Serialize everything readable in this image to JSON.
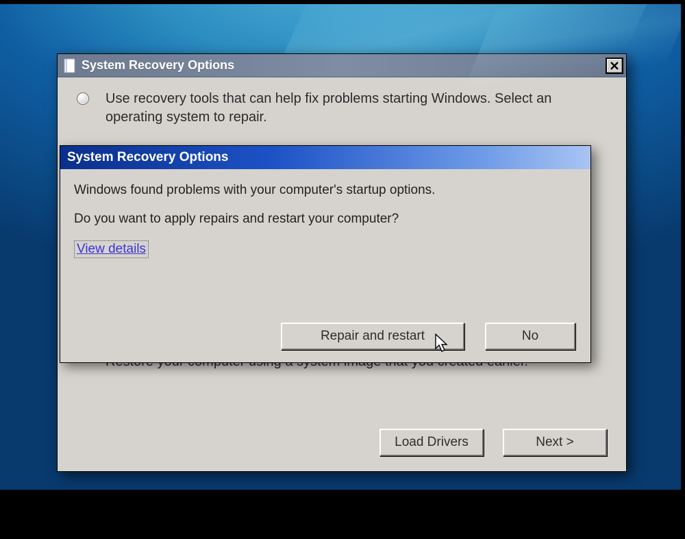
{
  "backWindow": {
    "title": "System Recovery Options",
    "option1": "Use recovery tools that can help fix problems starting Windows. Select an operating system to repair.",
    "option2_tail": "Restore your computer using a system image that you created earlier.",
    "loadDrivers": "Load Drivers",
    "next": "Next  >"
  },
  "dialog": {
    "title": "System Recovery Options",
    "line1": "Windows found problems with your computer's startup options.",
    "line2": "Do you want to apply repairs and restart your computer?",
    "viewDetails": "View details",
    "repair": "Repair and restart",
    "no": "No"
  }
}
